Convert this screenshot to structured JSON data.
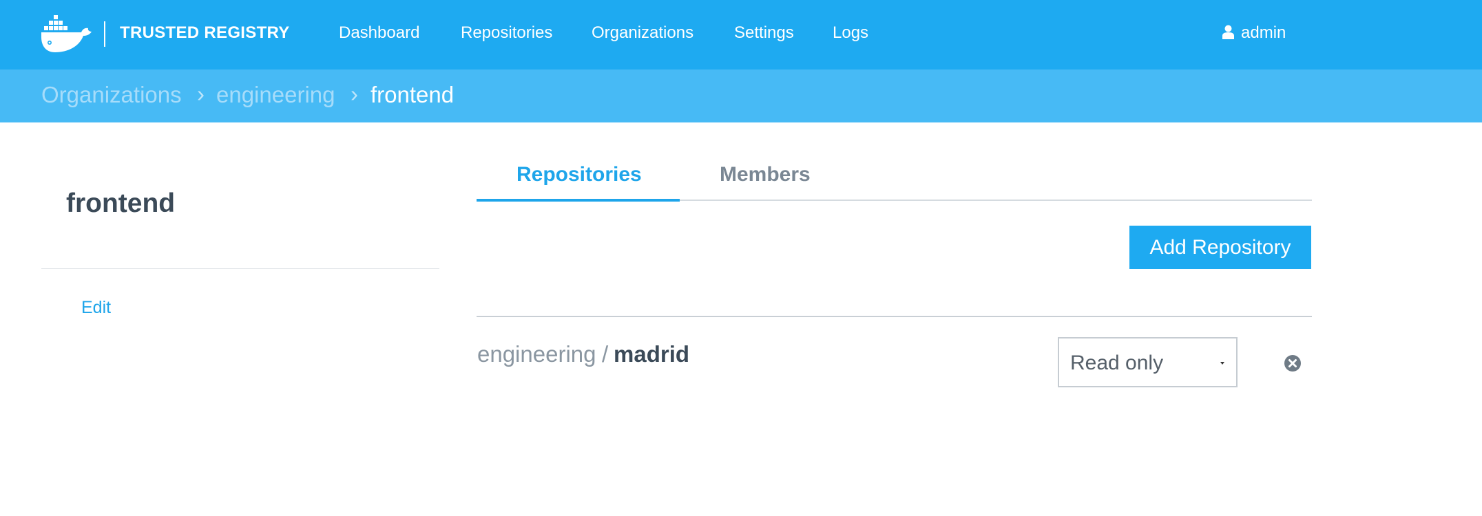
{
  "header": {
    "brand": "TRUSTED REGISTRY",
    "nav": [
      "Dashboard",
      "Repositories",
      "Organizations",
      "Settings",
      "Logs"
    ],
    "user": "admin",
    "logo_icon": "docker-whale-icon",
    "user_icon": "user-icon"
  },
  "breadcrumb": [
    "Organizations",
    "engineering",
    "frontend"
  ],
  "breadcrumb_separator": "›",
  "sidebar": {
    "title": "frontend",
    "edit_label": "Edit"
  },
  "tabs": [
    "Repositories",
    "Members"
  ],
  "active_tab": "Repositories",
  "actions": {
    "add_repository": "Add Repository"
  },
  "repositories": [
    {
      "namespace": "engineering",
      "separator": "/",
      "name": "madrid",
      "permission": "Read only"
    }
  ],
  "colors": {
    "header_bg": "#1eaaf1",
    "breadcrumb_bg": "#47baf5",
    "accent": "#1ea5ea",
    "title_text": "#3b4a58",
    "muted_text": "#8a96a1"
  }
}
